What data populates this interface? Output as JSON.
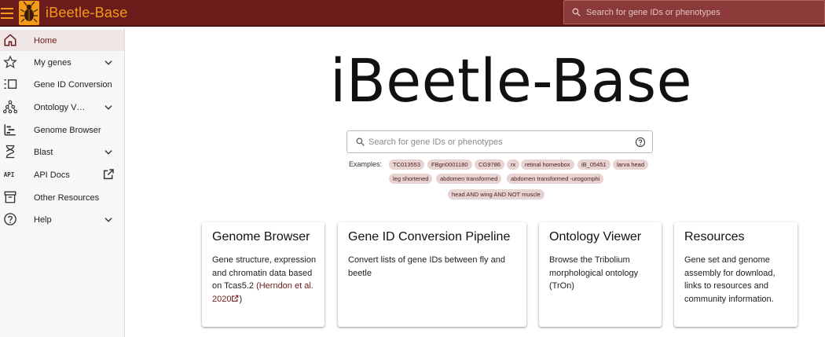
{
  "header": {
    "app_title": "iBeetle-Base",
    "search_placeholder": "Search for gene IDs or phenotypes"
  },
  "colors": {
    "brand": "#6b1c1a",
    "accent": "#f29a1a",
    "chip_bg": "#e7d3d1"
  },
  "sidebar": {
    "items": [
      {
        "label": "Home",
        "icon": "home-icon",
        "active": true
      },
      {
        "label": "My genes",
        "icon": "star-icon",
        "expandable": true
      },
      {
        "label": "Gene ID Conversion",
        "icon": "conversion-icon"
      },
      {
        "label": "Ontology V…",
        "icon": "ontology-icon",
        "expandable": true
      },
      {
        "label": "Genome Browser",
        "icon": "genome-browser-icon"
      },
      {
        "label": "Blast",
        "icon": "hourglass-icon",
        "expandable": true
      },
      {
        "label": "API Docs",
        "icon": "api-icon",
        "external": true
      },
      {
        "label": "Other Resources",
        "icon": "archive-icon"
      },
      {
        "label": "Help",
        "icon": "help-icon",
        "expandable": true
      }
    ]
  },
  "main": {
    "hero_title": "iBeetle-Base",
    "search_placeholder": "Search for gene IDs or phenotypes",
    "examples_label": "Examples:",
    "examples": [
      "TC013553",
      "FBgn0001180",
      "CG9786",
      "rx",
      "retinal homeobox",
      "iB_05451",
      "larva head",
      "leg shortened",
      "abdomen transformed",
      "abdomen transformed -urogomphi",
      "head AND wing AND NOT muscle"
    ],
    "cards": [
      {
        "title": "Genome Browser",
        "body": "Gene structure, expression and chromatin data based on Tcas5.2 ",
        "link": "(Herndon et al. 2020",
        "link_tail": ")"
      },
      {
        "title": "Gene ID Conversion Pipeline",
        "body": "Convert lists of gene IDs between fly and beetle"
      },
      {
        "title": "Ontology Viewer",
        "body": "Browse the Tribolium morphological ontology (TrOn)"
      },
      {
        "title": "Resources",
        "body": "Gene set and genome assembly for download, links to resources and community information."
      }
    ]
  }
}
